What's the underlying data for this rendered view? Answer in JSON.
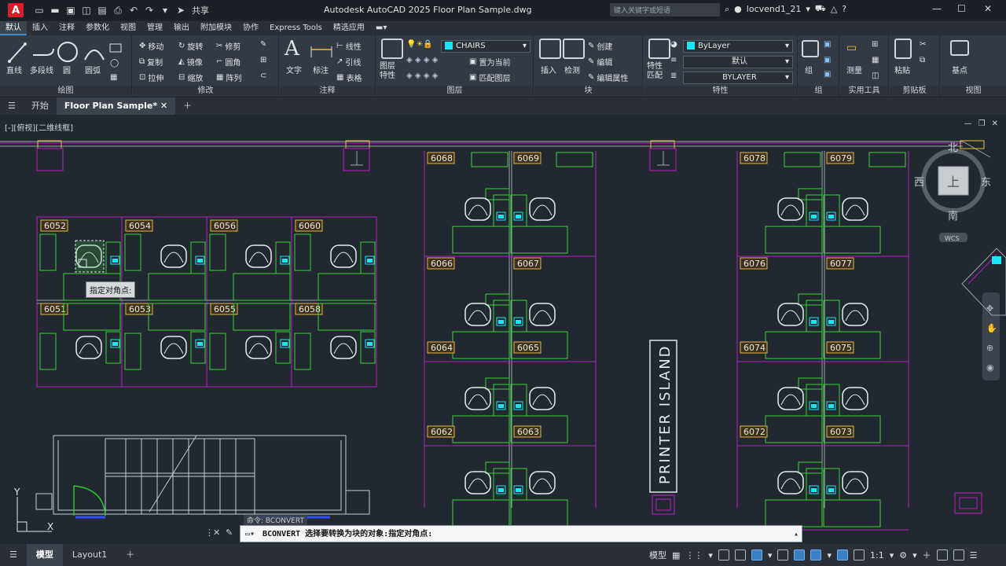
{
  "app": {
    "logo": "A",
    "title": "Autodesk AutoCAD 2025   Floor Plan Sample.dwg",
    "share": "共享",
    "search_placeholder": "键入关键字或短语",
    "user": "locvend1_21",
    "help": "?"
  },
  "ribbon_tabs": [
    "默认",
    "插入",
    "注释",
    "参数化",
    "视图",
    "管理",
    "输出",
    "附加模块",
    "协作",
    "Express Tools",
    "精选应用"
  ],
  "ribbon": {
    "draw": {
      "title": "绘图",
      "line": "直线",
      "polyline": "多段线",
      "circle": "圆",
      "arc": "圆弧"
    },
    "modify": {
      "title": "修改",
      "move": "移动",
      "rotate": "旋转",
      "trim": "修剪",
      "copy": "复制",
      "mirror": "镜像",
      "fillet": "圆角",
      "stretch": "拉伸",
      "scale": "缩放",
      "array": "阵列"
    },
    "annotation": {
      "title": "注释",
      "text": "文字",
      "dimension": "标注",
      "linear": "线性",
      "leader": "引线",
      "table": "表格"
    },
    "layers": {
      "title": "图层",
      "properties": "图层\n特性",
      "current_layer": "CHAIRS",
      "set_current": "置为当前",
      "match_layer": "匹配图层"
    },
    "block": {
      "title": "块",
      "insert": "插入",
      "inspect": "检测",
      "create": "创建",
      "edit": "编辑",
      "edit_attributes": "编辑属性"
    },
    "properties": {
      "title": "特性",
      "match": "特性\n匹配",
      "color": "ByLayer",
      "linetype": "默认",
      "lineweight": "BYLAYER"
    },
    "groups": {
      "title": "组",
      "group": "组"
    },
    "utilities": {
      "title": "实用工具",
      "measure": "测量"
    },
    "clipboard": {
      "title": "剪贴板",
      "paste": "粘贴"
    },
    "view": {
      "title": "视图",
      "base": "基点"
    }
  },
  "doc_tabs": {
    "start": "开始",
    "active": "Floor Plan Sample*"
  },
  "viewport": {
    "label": "[-][俯视][二维线框]",
    "tooltip": "指定对角点:",
    "viewcube": {
      "north": "北",
      "south": "南",
      "east": "东",
      "west": "西",
      "top": "上",
      "wcs": "WCS"
    },
    "ucs_x": "X",
    "ucs_y": "Y",
    "printer_island": "PRINTER ISLAND",
    "rooms_left": [
      "6052",
      "6054",
      "6056",
      "6060",
      "6051",
      "6053",
      "6055",
      "6058"
    ],
    "rooms_mid": [
      "6068",
      "6069",
      "6066",
      "6067",
      "6064",
      "6065",
      "6062",
      "6063"
    ],
    "rooms_right": [
      "6078",
      "6079",
      "6076",
      "6077",
      "6074",
      "6075",
      "6072",
      "6073"
    ]
  },
  "command": {
    "previous": "命令: BCONVERT",
    "current": "BCONVERT 选择要转换为块的对象:指定对角点:"
  },
  "statusbar": {
    "model": "模型",
    "layout1": "Layout1",
    "model_right": "模型",
    "scale": "1:1"
  }
}
